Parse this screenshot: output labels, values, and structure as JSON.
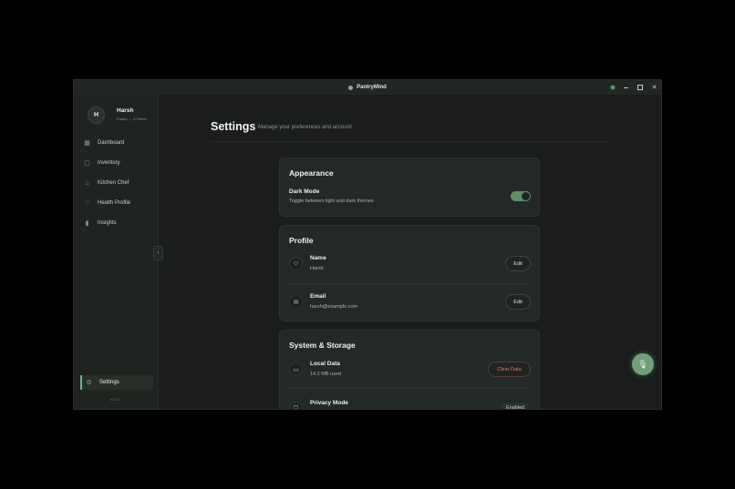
{
  "window": {
    "app_title": "PantryMind",
    "icons": {
      "app": "leaf-icon",
      "status": "status-dot-icon",
      "minimize": "minimize-icon",
      "maximize": "maximize-icon",
      "close": "close-icon"
    }
  },
  "sidebar": {
    "avatar_initial": "H",
    "user_name": "Harsh",
    "user_meta": "Pantry — 47 items",
    "items": [
      {
        "label": "Dashboard",
        "icon": "grid-icon"
      },
      {
        "label": "Inventory",
        "icon": "box-icon"
      },
      {
        "label": "Kitchen Chef",
        "icon": "chef-hat-icon"
      },
      {
        "label": "Health Profile",
        "icon": "heart-icon"
      },
      {
        "label": "Insights",
        "icon": "bar-chart-icon"
      }
    ],
    "settings_label": "Settings",
    "version": "v1.0.0",
    "collapse_glyph": "‹"
  },
  "page": {
    "title": "Settings",
    "subtitle": "Manage your preferences and account"
  },
  "appearance": {
    "title": "Appearance",
    "dark_mode_title": "Dark Mode",
    "dark_mode_sub": "Toggle between light and dark themes",
    "dark_mode_on": true
  },
  "profile": {
    "title": "Profile",
    "name_label": "Name",
    "name_value": "Harsh",
    "email_label": "Email",
    "email_value": "harsh@example.com",
    "edit_label": "Edit"
  },
  "system": {
    "title": "System & Storage",
    "local_data_title": "Local Data",
    "local_data_value": "14.2 MB used",
    "clear_label": "Clear Data",
    "privacy_title": "Privacy Mode",
    "privacy_badge": "Enabled"
  },
  "colors": {
    "accent": "#6fa07a",
    "danger": "#e27a66",
    "background": "#1a1d1b"
  }
}
